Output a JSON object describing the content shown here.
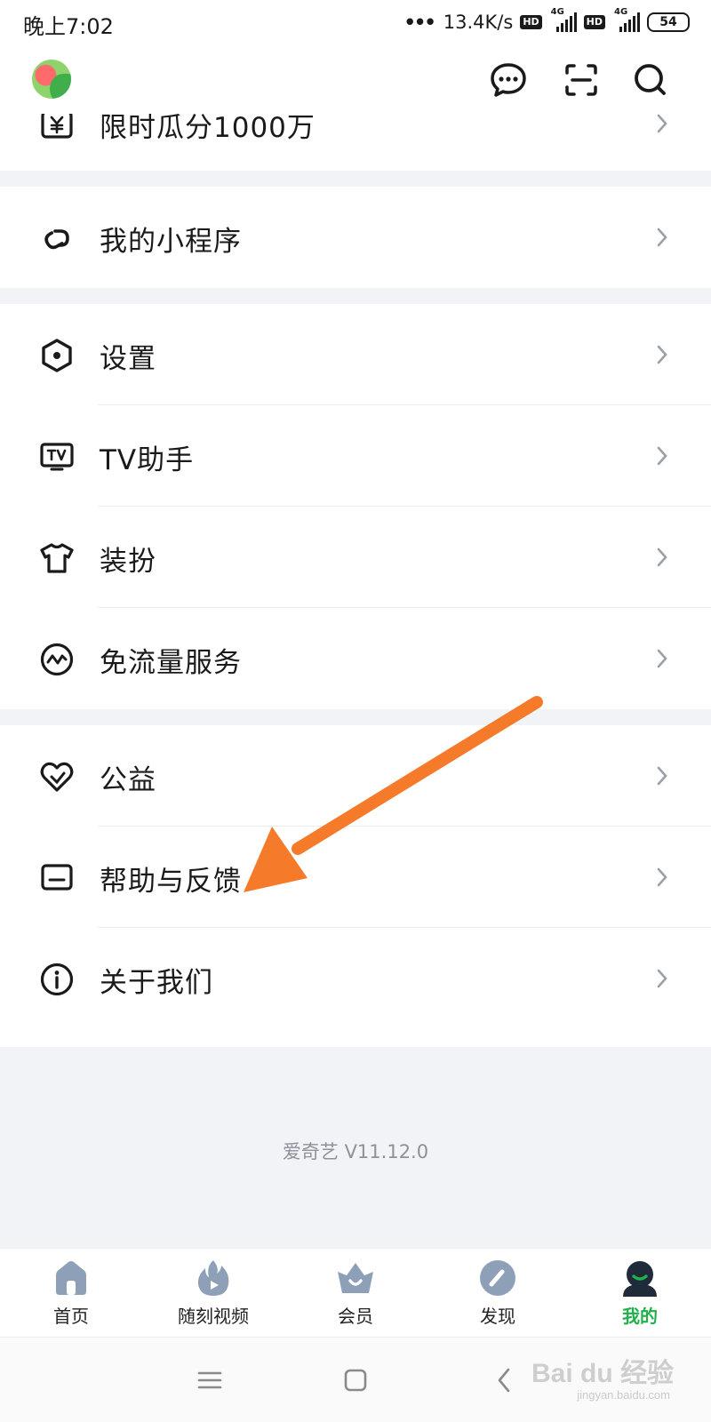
{
  "status_bar": {
    "time": "晚上7:02",
    "dots": "•••",
    "speed": "13.4K/s",
    "hd1": "HD",
    "hd2": "HD",
    "net1": "4G",
    "net2": "4G",
    "battery": "54"
  },
  "header": {
    "avatar_icon": "avatar-icon",
    "actions": [
      "message-icon",
      "scan-icon",
      "search-icon"
    ]
  },
  "menu": {
    "partial_item": {
      "label": "限时瓜分1000万",
      "icon": "wallet-yen-icon"
    },
    "mini_program": {
      "label": "我的小程序",
      "icon": "link-icon"
    },
    "settings": {
      "label": "设置",
      "icon": "hexagon-gear-icon"
    },
    "tv_assistant": {
      "label": "TV助手",
      "icon": "tv-icon"
    },
    "dress_up": {
      "label": "装扮",
      "icon": "tshirt-icon"
    },
    "free_data": {
      "label": "免流量服务",
      "icon": "data-wave-icon"
    },
    "charity": {
      "label": "公益",
      "icon": "heart-icon"
    },
    "help_feedback": {
      "label": "帮助与反馈",
      "icon": "message-box-icon"
    },
    "about_us": {
      "label": "关于我们",
      "icon": "info-icon"
    }
  },
  "version": "爱奇艺 V11.12.0",
  "tabs": [
    {
      "label": "首页",
      "icon": "home-icon",
      "active": false
    },
    {
      "label": "随刻视频",
      "icon": "flame-icon",
      "active": false
    },
    {
      "label": "会员",
      "icon": "crown-icon",
      "active": false
    },
    {
      "label": "发现",
      "icon": "compass-icon",
      "active": false
    },
    {
      "label": "我的",
      "icon": "profile-icon",
      "active": true
    }
  ],
  "colors": {
    "accent_green": "#21b14a",
    "annotation_arrow": "#f57a2a",
    "tab_icon_gray": "#8ea0b8",
    "section_gap": "#f1f3f7"
  },
  "watermark": {
    "main": "Bai du 经验",
    "sub": "jingyan.baidu.com"
  }
}
